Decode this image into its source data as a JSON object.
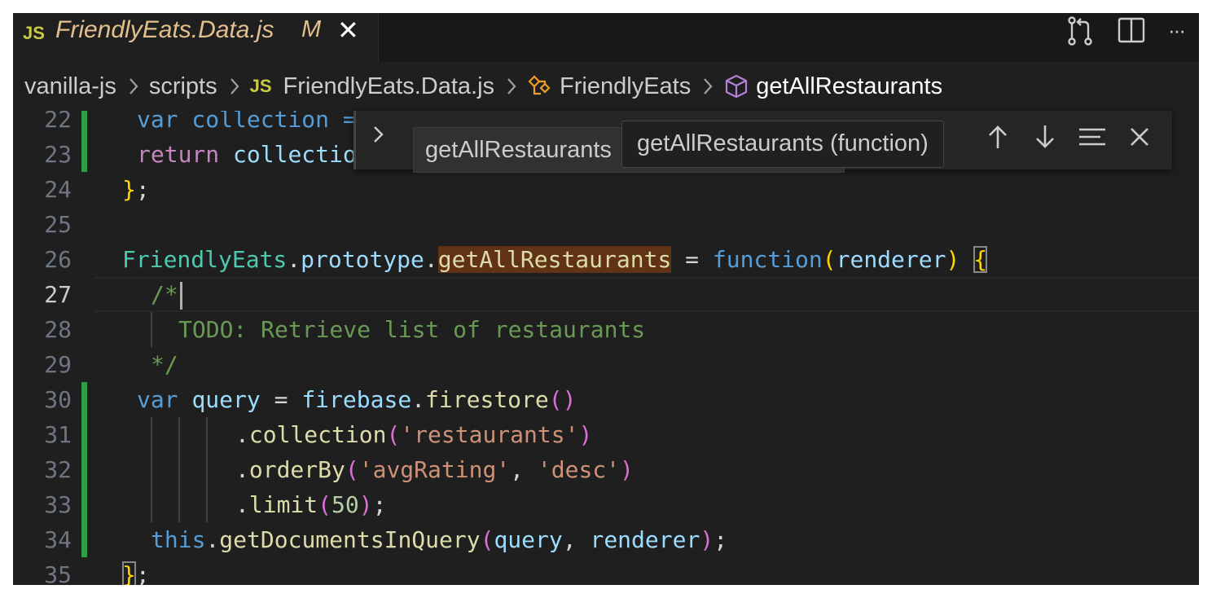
{
  "tab": {
    "icon": "JS",
    "filename": "FriendlyEats.Data.js",
    "status": "M",
    "close": "✕"
  },
  "toolbar": {
    "more": "···"
  },
  "breadcrumb": {
    "folder1": "vanilla-js",
    "folder2": "scripts",
    "file_icon": "JS",
    "file": "FriendlyEats.Data.js",
    "class": "FriendlyEats",
    "method": "getAllRestaurants"
  },
  "find": {
    "value": "getAllRestaurants",
    "tooltip": "getAllRestaurants (function)"
  },
  "editor": {
    "line_numbers": [
      "22",
      "23",
      "24",
      "25",
      "26",
      "27",
      "28",
      "29",
      "30",
      "31",
      "32",
      "33",
      "34",
      "35"
    ],
    "current_line": "27",
    "code": {
      "l22": "var collection =",
      "l23_kw": "return",
      "l23_var": "collectio",
      "l24_brace": "}",
      "l24_semi": ";",
      "l26_class": "FriendlyEats",
      "l26_dot1": ".",
      "l26_proto": "prototype",
      "l26_dot2": ".",
      "l26_method": "getAllRestaurants",
      "l26_eq": " = ",
      "l26_fnkw": "function",
      "l26_lp": "(",
      "l26_param": "renderer",
      "l26_rp": ")",
      "l26_brace": "{",
      "l27": "/*",
      "l28": "TODO: Retrieve list of restaurants",
      "l29": "*/",
      "l30_kw": "var",
      "l30_var": "query",
      "l30_eq": " = ",
      "l30_obj": "firebase",
      "l30_dot": ".",
      "l30_fn": "firestore",
      "l30_parens": "()",
      "l31_dot": ".",
      "l31_fn": "collection",
      "l31_lp": "(",
      "l31_str": "'restaurants'",
      "l31_rp": ")",
      "l32_dot": ".",
      "l32_fn": "orderBy",
      "l32_lp": "(",
      "l32_str1": "'avgRating'",
      "l32_comma": ", ",
      "l32_str2": "'desc'",
      "l32_rp": ")",
      "l33_dot": ".",
      "l33_fn": "limit",
      "l33_lp": "(",
      "l33_num": "50",
      "l33_rp": ")",
      "l33_semi": ";",
      "l34_this": "this",
      "l34_dot": ".",
      "l34_fn": "getDocumentsInQuery",
      "l34_lp": "(",
      "l34_a1": "query",
      "l34_comma": ", ",
      "l34_a2": "renderer",
      "l34_rp": ")",
      "l34_semi": ";",
      "l35_brace": "}",
      "l35_semi": ";"
    }
  },
  "colors": {
    "editor_bg": "#1f1f1f",
    "modified_gutter": "#2ea043",
    "find_match": "#613214",
    "modified_tab": "#e2c08d"
  }
}
